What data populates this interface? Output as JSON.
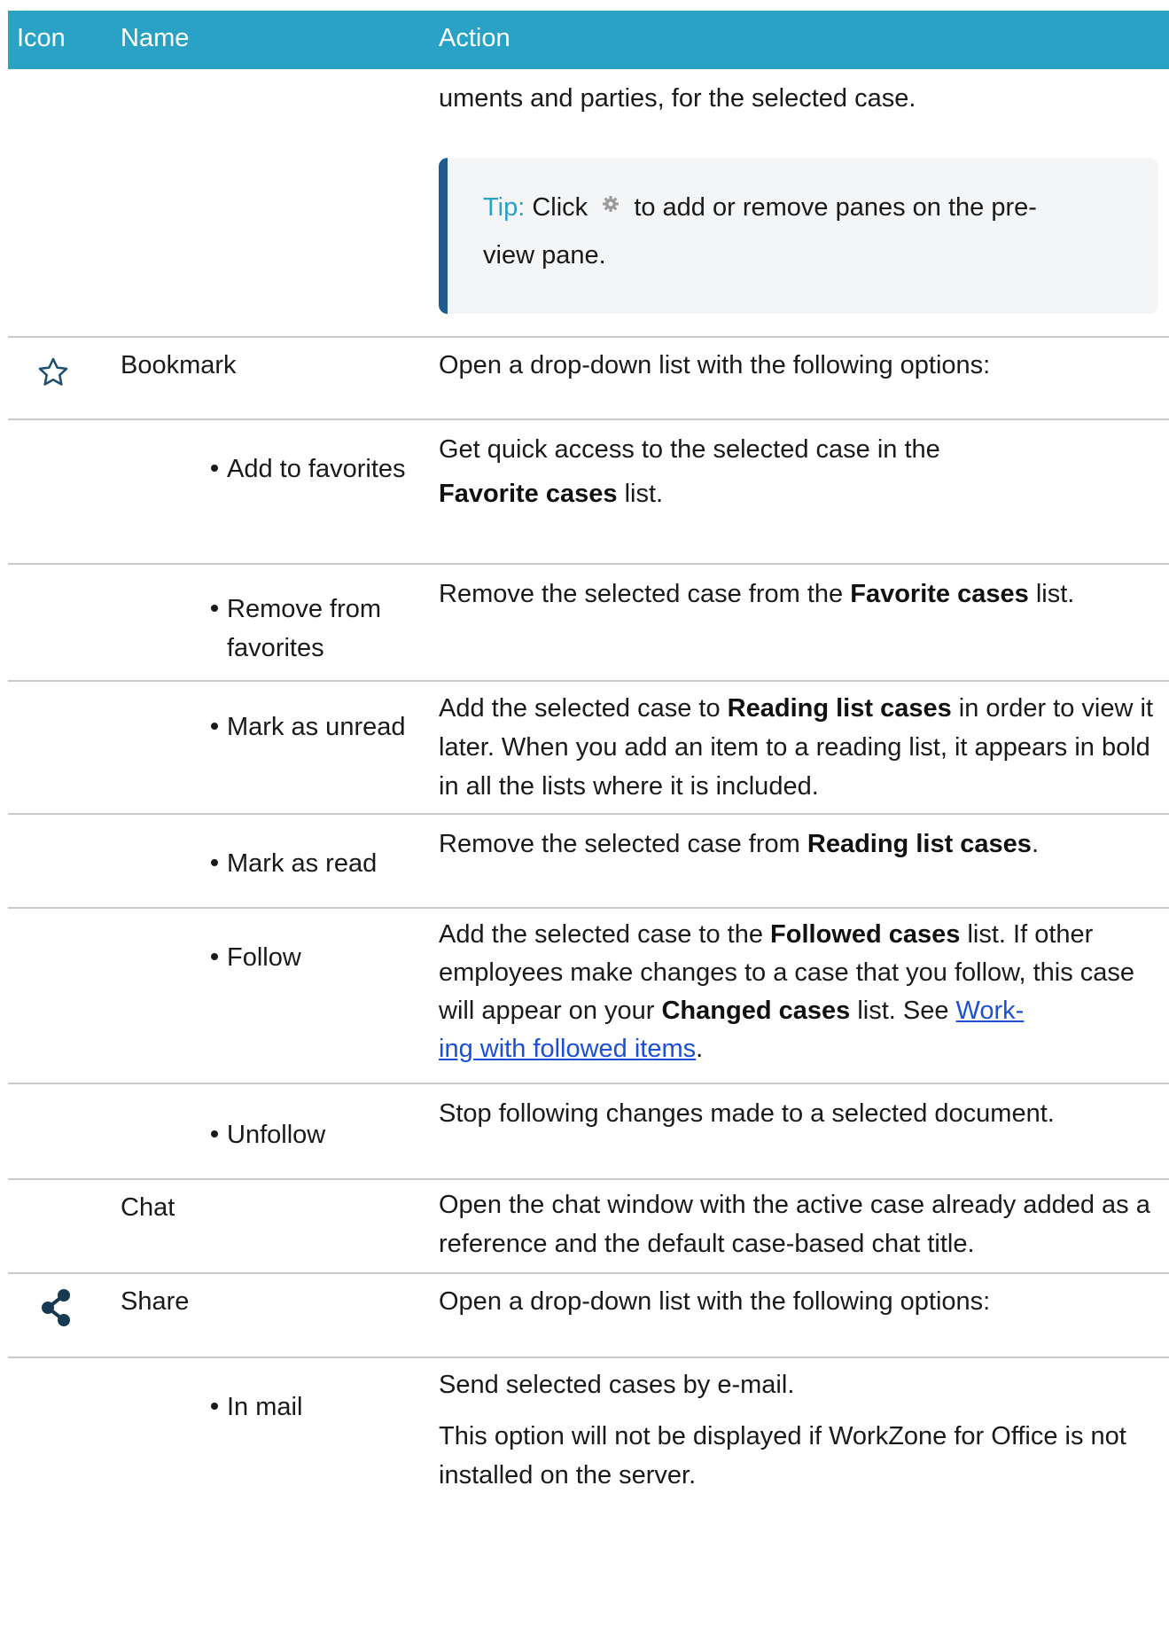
{
  "header": {
    "icon": "Icon",
    "name": "Name",
    "action": "Action"
  },
  "first_row": {
    "action_text": "uments and parties, for the selected case.",
    "tip": {
      "label": "Tip:",
      "pre": "Click",
      "icon": "gear-icon",
      "post_line1": "to add or remove panes on the pre-",
      "post_line2": "view pane."
    }
  },
  "rows": {
    "bookmark": {
      "icon": "star-outline-icon",
      "name": "Bookmark",
      "action": "Open a drop-down list with the following options:"
    },
    "add_to_favorites": {
      "name": "Add to favorites",
      "action_pre": "Get quick access to the selected case in the",
      "action_bold": "Favorite cases",
      "action_post": "list."
    },
    "remove_from_favorites": {
      "name_line1": "Remove from",
      "name_line2": "favorites",
      "action_pre": "Remove the selected case from the",
      "action_bold": "Favorite cases",
      "action_post": "list."
    },
    "mark_as_unread": {
      "name": "Mark as unread",
      "action_pre": "Add the selected case to",
      "action_bold": "Reading list cases",
      "action_post": "in order to view it later. When you add an item to a reading list, it appears in bold in all the lists where it is included."
    },
    "mark_as_read": {
      "name": "Mark as read",
      "action_pre": "Remove the selected case from",
      "action_bold": "Reading list cases",
      "action_post": "."
    },
    "follow": {
      "name": "Follow",
      "action_pre": "Add the selected case to the",
      "action_bold1": "Followed cases",
      "action_mid": "list. If other employees make changes to a case that you follow, this case will appear on your",
      "action_bold2": "Changed cases",
      "action_mid2": "list. See",
      "link_line1": "Work-",
      "link_line2": "ing with followed items",
      "action_post": "."
    },
    "unfollow": {
      "name": "Unfollow",
      "action": "Stop following changes made to a selected document."
    },
    "chat": {
      "name": "Chat",
      "action": "Open the chat window with the active case already added as a reference and the default case-based chat title."
    },
    "share": {
      "icon": "share-icon",
      "name": "Share",
      "action": "Open a drop-down list with the following options:"
    },
    "in_mail": {
      "name": "In mail",
      "action_p1": "Send selected cases by e-mail.",
      "action_p2": "This option will not be displayed if WorkZone for Office is not installed on the server."
    }
  }
}
